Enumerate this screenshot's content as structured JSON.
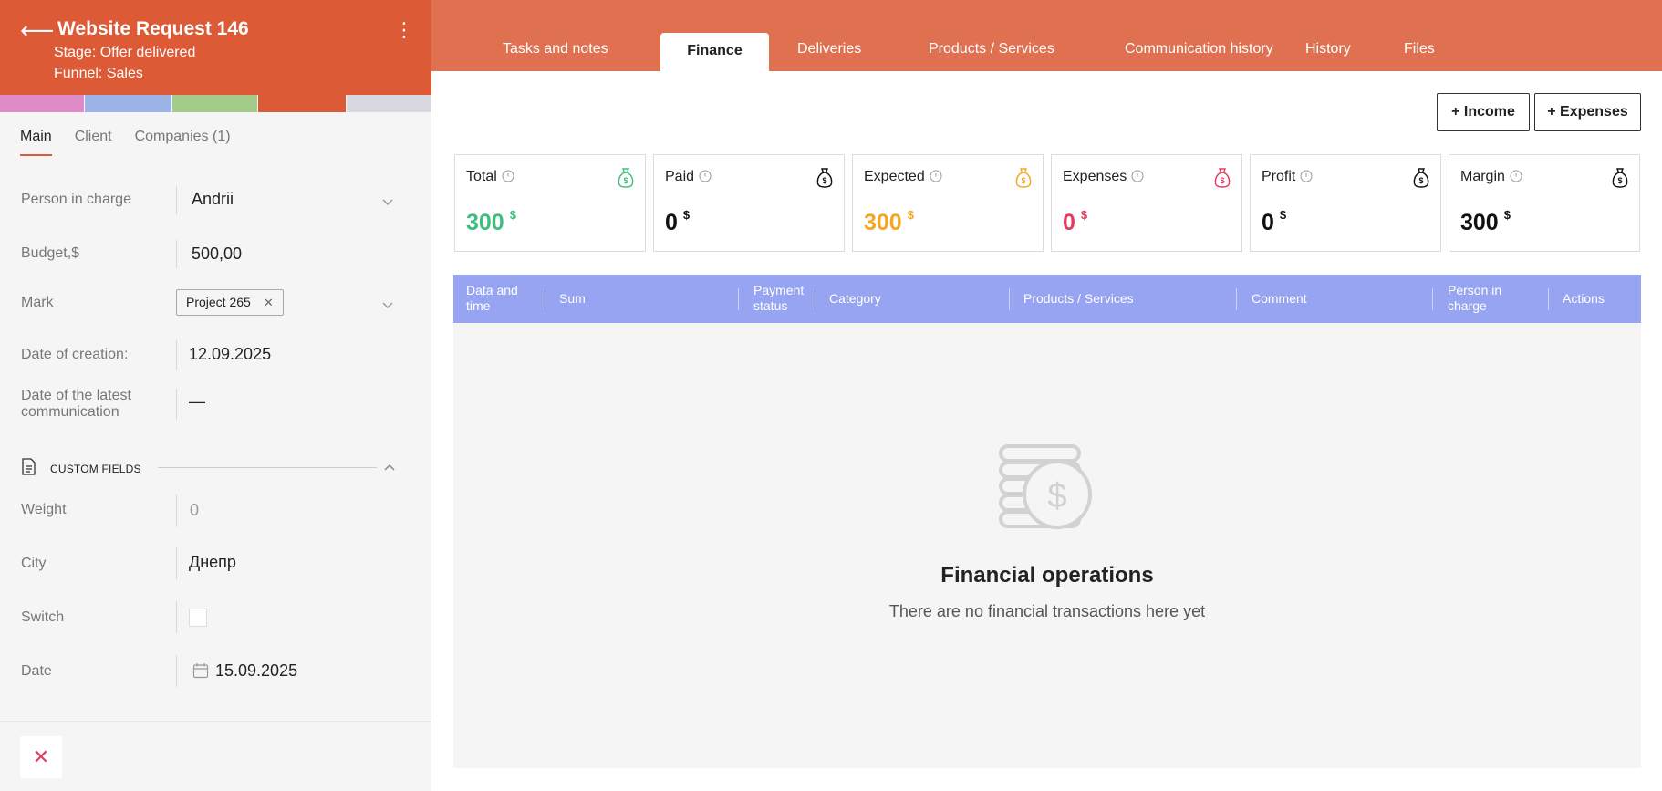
{
  "header": {
    "title": "Website Request 146",
    "stage": "Stage: Offer delivered",
    "funnel": "Funnel: Sales"
  },
  "stage_colors": [
    "#e089c7",
    "#9bb3e6",
    "#a3cc89",
    "#dd5a37",
    "#d8d8e0"
  ],
  "left_tabs": [
    {
      "label": "Main",
      "active": true
    },
    {
      "label": "Client",
      "active": false
    },
    {
      "label": "Companies (1)",
      "active": false
    }
  ],
  "fields": {
    "person_in_charge": {
      "label": "Person in charge",
      "value": "Andrii"
    },
    "budget": {
      "label": "Budget,$",
      "value": "500,00"
    },
    "mark": {
      "label": "Mark",
      "tag": "Project 265"
    },
    "date_created": {
      "label": "Date of creation:",
      "value": "12.09.2025"
    },
    "date_latest": {
      "label_1": "Date of the latest",
      "label_2": "communication",
      "value": "—"
    }
  },
  "custom_fields": {
    "title": "CUSTOM FIELDS",
    "weight": {
      "label": "Weight",
      "value": "0"
    },
    "city": {
      "label": "City",
      "value": "Днепр"
    },
    "switch": {
      "label": "Switch"
    },
    "date": {
      "label": "Date",
      "value": "15.09.2025"
    }
  },
  "tabs": [
    {
      "label": "Tasks and notes"
    },
    {
      "label": "Finance",
      "active": true
    },
    {
      "label": "Deliveries"
    },
    {
      "label": "Products / Services"
    },
    {
      "label": "Communication history"
    },
    {
      "label": "History"
    },
    {
      "label": "Files"
    }
  ],
  "actions": {
    "income": "+ Income",
    "expenses": "+ Expenses"
  },
  "cards": [
    {
      "label": "Total",
      "value": "300",
      "unit": "$",
      "color": "#3fbf7f",
      "icon": "money-bag-icon"
    },
    {
      "label": "Paid",
      "value": "0",
      "unit": "$",
      "color": "#111111",
      "icon": "money-bag-icon"
    },
    {
      "label": "Expected",
      "value": "300",
      "unit": "$",
      "color": "#f5a623",
      "icon": "money-bag-icon"
    },
    {
      "label": "Expenses",
      "value": "0",
      "unit": "$",
      "color": "#e43b5e",
      "icon": "money-bag-icon"
    },
    {
      "label": "Profit",
      "value": "0",
      "unit": "$",
      "color": "#111111",
      "icon": "money-bag-icon"
    },
    {
      "label": "Margin",
      "value": "300",
      "unit": "$",
      "color": "#111111",
      "icon": "money-bag-icon"
    }
  ],
  "table": {
    "columns": [
      {
        "l1": "Data and",
        "l2": "time"
      },
      {
        "l1": "Sum"
      },
      {
        "l1": "Payment",
        "l2": "status"
      },
      {
        "l1": "Category"
      },
      {
        "l1": "Products / Services"
      },
      {
        "l1": "Comment"
      },
      {
        "l1": "Person in",
        "l2": "charge"
      },
      {
        "l1": "Actions"
      }
    ],
    "header_color": "#97a4f2"
  },
  "empty": {
    "title": "Financial operations",
    "subtitle": "There are no financial transactions here yet"
  },
  "colors": {
    "accent": "#dd5a37",
    "topbar": "#df7150",
    "danger": "#e43b5e"
  }
}
